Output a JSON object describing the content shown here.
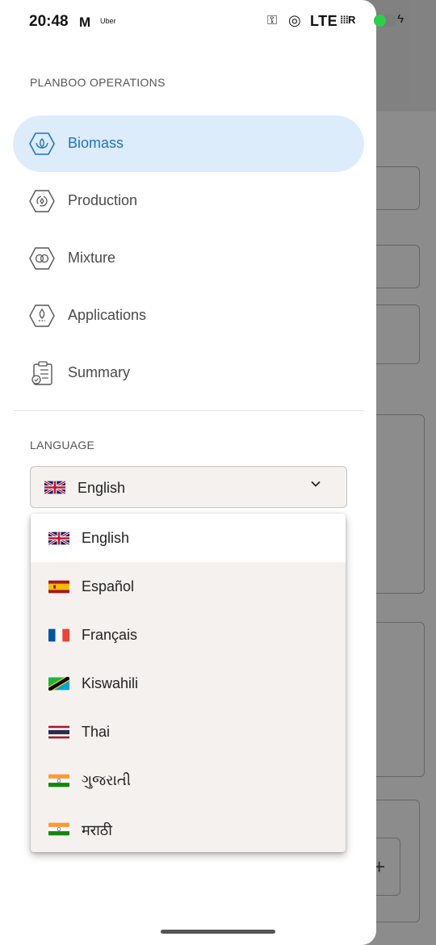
{
  "status_bar": {
    "time": "20:48",
    "network": "LTE",
    "battery_level": 0.55
  },
  "drawer": {
    "section_operations": "PLANBOO OPERATIONS",
    "nav_items": [
      {
        "label": "Biomass",
        "icon": "biomass-icon",
        "active": true
      },
      {
        "label": "Production",
        "icon": "production-icon",
        "active": false
      },
      {
        "label": "Mixture",
        "icon": "mixture-icon",
        "active": false
      },
      {
        "label": "Applications",
        "icon": "applications-icon",
        "active": false
      },
      {
        "label": "Summary",
        "icon": "clipboard-icon",
        "active": false
      }
    ],
    "section_language": "LANGUAGE",
    "language_select": {
      "selected": "English",
      "flag": "uk-flag-icon"
    },
    "language_options": [
      {
        "label": "English",
        "flag": "uk-flag-icon",
        "selected": true
      },
      {
        "label": "Español",
        "flag": "spain-flag-icon",
        "selected": false
      },
      {
        "label": "Français",
        "flag": "france-flag-icon",
        "selected": false
      },
      {
        "label": "Kiswahili",
        "flag": "tanzania-flag-icon",
        "selected": false
      },
      {
        "label": "Thai",
        "flag": "thailand-flag-icon",
        "selected": false
      },
      {
        "label": "ગુજરાતી",
        "flag": "india-flag-icon",
        "selected": false
      },
      {
        "label": "मराठी",
        "flag": "india-flag-icon",
        "selected": false
      }
    ]
  },
  "colors": {
    "accent": "#1f73c2",
    "active_bg": "#dcecfb",
    "menu_bg": "#f4f1ef"
  }
}
